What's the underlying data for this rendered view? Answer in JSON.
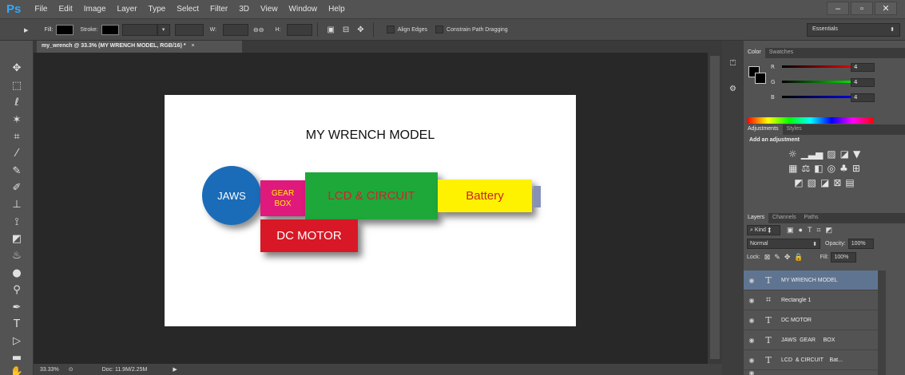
{
  "app": {
    "logo": "Ps"
  },
  "menu": [
    "File",
    "Edit",
    "Image",
    "Layer",
    "Type",
    "Select",
    "Filter",
    "3D",
    "View",
    "Window",
    "Help"
  ],
  "window_buttons": [
    "–",
    "▫",
    "✕"
  ],
  "options": {
    "fill_label": "Fill:",
    "stroke_label": "Stroke:",
    "w_label": "W:",
    "link_glyph": "⊖⊖",
    "h_label": "H:",
    "align_edges": "Align Edges",
    "constrain": "Constrain Path Dragging",
    "workspace": "Essentials"
  },
  "document": {
    "tab_title": "my_wrench @ 33.3% (MY WRENCH MODEL, RGB/16) *",
    "zoom": "33.33%",
    "doc_size": "Doc: 11.9M/2.25M",
    "title": "MY WRENCH MODEL",
    "parts": {
      "jaws": "JAWS",
      "gear_line1": "GEAR",
      "gear_line2": "BOX",
      "lcd": "LCD & CIRCUIT",
      "battery": "Battery",
      "motor": "DC MOTOR"
    },
    "colors": {
      "jaws": "#1b6cb8",
      "gear": "#e0197c",
      "lcd": "#1fa83a",
      "battery": "#fff200",
      "motor": "#d81826"
    }
  },
  "color_panel": {
    "tabs": [
      "Color",
      "Swatches"
    ],
    "r_label": "R",
    "g_label": "G",
    "b_label": "B",
    "r": "4",
    "g": "4",
    "b": "4"
  },
  "adjustments": {
    "tabs": [
      "Adjustments",
      "Styles"
    ],
    "title": "Add an adjustment"
  },
  "layers": {
    "tabs": [
      "Layers",
      "Channels",
      "Paths"
    ],
    "kind": "Kind",
    "blend": "Normal",
    "opacity_label": "Opacity:",
    "opacity": "100%",
    "lock_label": "Lock:",
    "fill_label": "Fill:",
    "fill": "100%",
    "items": [
      {
        "name": "MY WRENCH MODEL",
        "type": "T"
      },
      {
        "name": "Rectangle 1",
        "type": "⌗"
      },
      {
        "name": "DC MOTOR",
        "type": "T"
      },
      {
        "name": "JAWS  GEAR     BOX",
        "type": "T"
      },
      {
        "name": "LCD  & CIRCUIT    Bat...",
        "type": "T"
      }
    ]
  }
}
